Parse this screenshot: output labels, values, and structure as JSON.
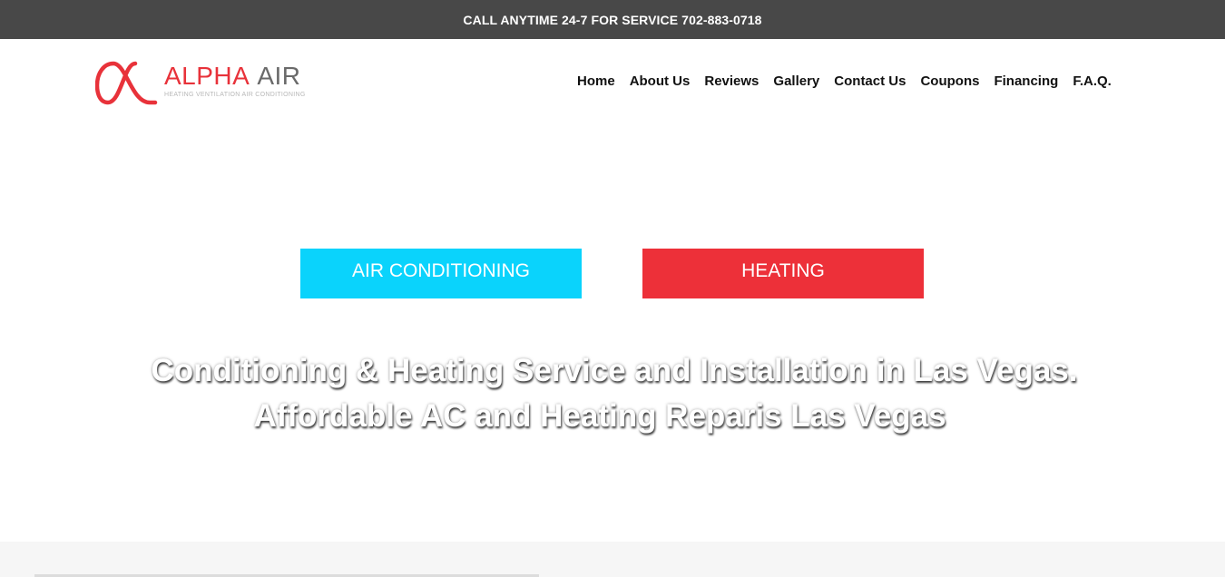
{
  "topbar": {
    "text": "CALL ANYTIME 24-7 FOR SERVICE 702-883-0718"
  },
  "logo": {
    "mark_icon": "alpha-symbol-icon",
    "name_primary": "ALPHA",
    "name_secondary": "AIR",
    "tagline": "HEATING VENTILATION AIR CONDITIONING",
    "colors": {
      "primary": "#e8323a",
      "secondary": "#6a6a6a"
    }
  },
  "nav": {
    "items": [
      {
        "label": "Home"
      },
      {
        "label": "About Us"
      },
      {
        "label": "Reviews"
      },
      {
        "label": "Gallery"
      },
      {
        "label": "Contact Us"
      },
      {
        "label": "Coupons"
      },
      {
        "label": "Financing"
      },
      {
        "label": "F.A.Q."
      }
    ]
  },
  "hero": {
    "buttons": [
      {
        "label": "AIR CONDITIONING",
        "color": "#0ad3fc"
      },
      {
        "label": "HEATING",
        "color": "#ed3039"
      }
    ],
    "headline_line1": "Conditioning & Heating Service and Installation in Las Vegas.",
    "headline_line2": "Affordable AC and Heating Reparis Las Vegas"
  },
  "colors": {
    "topbar_bg": "#484848",
    "page_bg": "#ffffff",
    "footer_band": "#f6f6f6"
  }
}
